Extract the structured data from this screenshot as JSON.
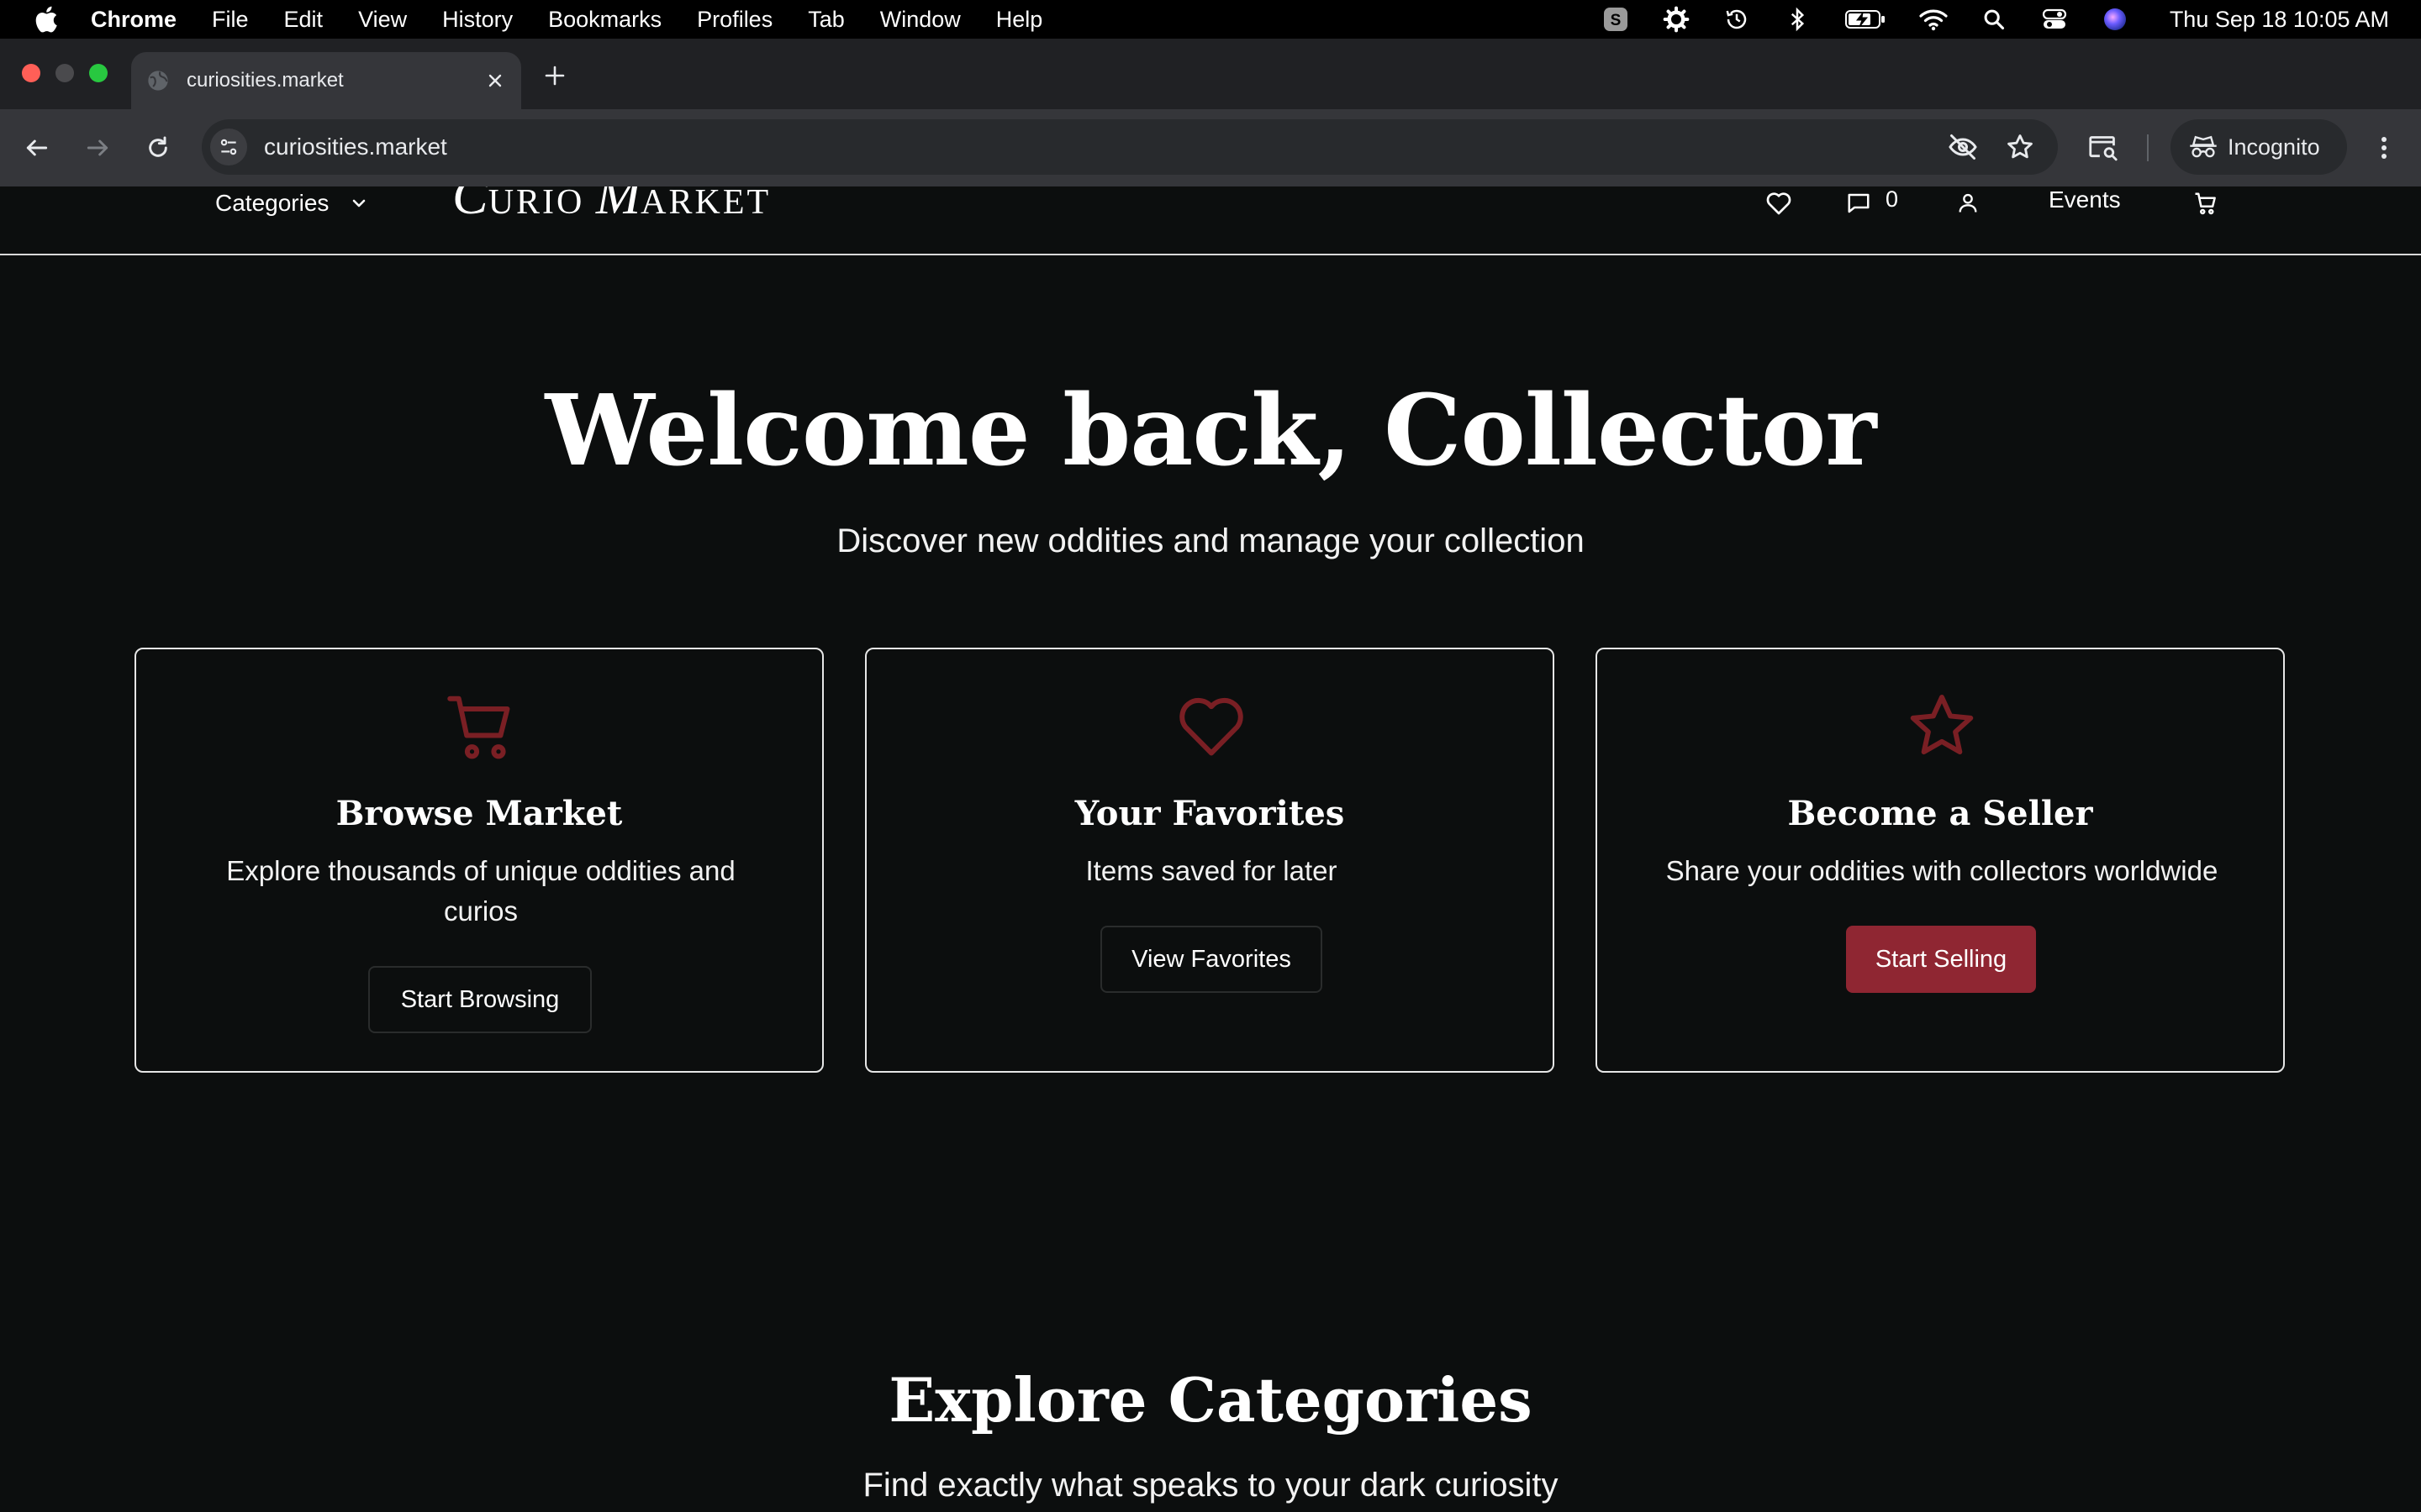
{
  "menubar": {
    "app_name": "Chrome",
    "items": [
      "File",
      "Edit",
      "View",
      "History",
      "Bookmarks",
      "Profiles",
      "Tab",
      "Window",
      "Help"
    ],
    "clock": "Thu Sep 18  10:05 AM"
  },
  "browser": {
    "tab_title": "curiosities.market",
    "url": "curiosities.market",
    "incognito_label": "Incognito"
  },
  "nav": {
    "categories_label": "Categories",
    "logo_initial_1": "C",
    "logo_rest_1": "URIO ",
    "logo_initial_2": "M",
    "logo_rest_2": "ARKET",
    "messages_count": "0",
    "events_label": "Events"
  },
  "hero": {
    "title": "Welcome back, Collector",
    "subtitle": "Discover new oddities and manage your collection"
  },
  "cards": [
    {
      "icon": "cart-icon",
      "title": "Browse Market",
      "description": "Explore thousands of unique oddities and curios",
      "button": "Start Browsing"
    },
    {
      "icon": "heart-icon",
      "title": "Your Favorites",
      "description": "Items saved for later",
      "button": "View Favorites"
    },
    {
      "icon": "star-icon",
      "title": "Become a Seller",
      "description": "Share your oddities with collectors worldwide",
      "button": "Start Selling"
    }
  ],
  "explore": {
    "title": "Explore Categories",
    "subtitle": "Find exactly what speaks to your dark curiosity"
  },
  "colors": {
    "page_background": "#0c0e0e",
    "accent": "#8f2632",
    "icon_accent": "#7a1f24"
  }
}
